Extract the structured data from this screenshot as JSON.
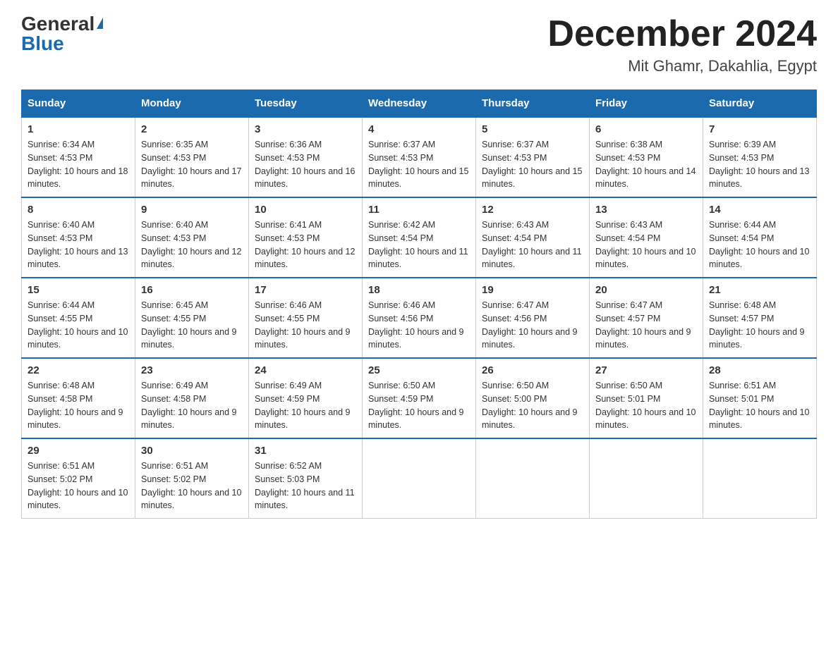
{
  "logo": {
    "general": "General",
    "triangle": "▶",
    "blue": "Blue"
  },
  "title": "December 2024",
  "subtitle": "Mit Ghamr, Dakahlia, Egypt",
  "days_of_week": [
    "Sunday",
    "Monday",
    "Tuesday",
    "Wednesday",
    "Thursday",
    "Friday",
    "Saturday"
  ],
  "weeks": [
    [
      {
        "day": "1",
        "sunrise": "6:34 AM",
        "sunset": "4:53 PM",
        "daylight": "10 hours and 18 minutes."
      },
      {
        "day": "2",
        "sunrise": "6:35 AM",
        "sunset": "4:53 PM",
        "daylight": "10 hours and 17 minutes."
      },
      {
        "day": "3",
        "sunrise": "6:36 AM",
        "sunset": "4:53 PM",
        "daylight": "10 hours and 16 minutes."
      },
      {
        "day": "4",
        "sunrise": "6:37 AM",
        "sunset": "4:53 PM",
        "daylight": "10 hours and 15 minutes."
      },
      {
        "day": "5",
        "sunrise": "6:37 AM",
        "sunset": "4:53 PM",
        "daylight": "10 hours and 15 minutes."
      },
      {
        "day": "6",
        "sunrise": "6:38 AM",
        "sunset": "4:53 PM",
        "daylight": "10 hours and 14 minutes."
      },
      {
        "day": "7",
        "sunrise": "6:39 AM",
        "sunset": "4:53 PM",
        "daylight": "10 hours and 13 minutes."
      }
    ],
    [
      {
        "day": "8",
        "sunrise": "6:40 AM",
        "sunset": "4:53 PM",
        "daylight": "10 hours and 13 minutes."
      },
      {
        "day": "9",
        "sunrise": "6:40 AM",
        "sunset": "4:53 PM",
        "daylight": "10 hours and 12 minutes."
      },
      {
        "day": "10",
        "sunrise": "6:41 AM",
        "sunset": "4:53 PM",
        "daylight": "10 hours and 12 minutes."
      },
      {
        "day": "11",
        "sunrise": "6:42 AM",
        "sunset": "4:54 PM",
        "daylight": "10 hours and 11 minutes."
      },
      {
        "day": "12",
        "sunrise": "6:43 AM",
        "sunset": "4:54 PM",
        "daylight": "10 hours and 11 minutes."
      },
      {
        "day": "13",
        "sunrise": "6:43 AM",
        "sunset": "4:54 PM",
        "daylight": "10 hours and 10 minutes."
      },
      {
        "day": "14",
        "sunrise": "6:44 AM",
        "sunset": "4:54 PM",
        "daylight": "10 hours and 10 minutes."
      }
    ],
    [
      {
        "day": "15",
        "sunrise": "6:44 AM",
        "sunset": "4:55 PM",
        "daylight": "10 hours and 10 minutes."
      },
      {
        "day": "16",
        "sunrise": "6:45 AM",
        "sunset": "4:55 PM",
        "daylight": "10 hours and 9 minutes."
      },
      {
        "day": "17",
        "sunrise": "6:46 AM",
        "sunset": "4:55 PM",
        "daylight": "10 hours and 9 minutes."
      },
      {
        "day": "18",
        "sunrise": "6:46 AM",
        "sunset": "4:56 PM",
        "daylight": "10 hours and 9 minutes."
      },
      {
        "day": "19",
        "sunrise": "6:47 AM",
        "sunset": "4:56 PM",
        "daylight": "10 hours and 9 minutes."
      },
      {
        "day": "20",
        "sunrise": "6:47 AM",
        "sunset": "4:57 PM",
        "daylight": "10 hours and 9 minutes."
      },
      {
        "day": "21",
        "sunrise": "6:48 AM",
        "sunset": "4:57 PM",
        "daylight": "10 hours and 9 minutes."
      }
    ],
    [
      {
        "day": "22",
        "sunrise": "6:48 AM",
        "sunset": "4:58 PM",
        "daylight": "10 hours and 9 minutes."
      },
      {
        "day": "23",
        "sunrise": "6:49 AM",
        "sunset": "4:58 PM",
        "daylight": "10 hours and 9 minutes."
      },
      {
        "day": "24",
        "sunrise": "6:49 AM",
        "sunset": "4:59 PM",
        "daylight": "10 hours and 9 minutes."
      },
      {
        "day": "25",
        "sunrise": "6:50 AM",
        "sunset": "4:59 PM",
        "daylight": "10 hours and 9 minutes."
      },
      {
        "day": "26",
        "sunrise": "6:50 AM",
        "sunset": "5:00 PM",
        "daylight": "10 hours and 9 minutes."
      },
      {
        "day": "27",
        "sunrise": "6:50 AM",
        "sunset": "5:01 PM",
        "daylight": "10 hours and 10 minutes."
      },
      {
        "day": "28",
        "sunrise": "6:51 AM",
        "sunset": "5:01 PM",
        "daylight": "10 hours and 10 minutes."
      }
    ],
    [
      {
        "day": "29",
        "sunrise": "6:51 AM",
        "sunset": "5:02 PM",
        "daylight": "10 hours and 10 minutes."
      },
      {
        "day": "30",
        "sunrise": "6:51 AM",
        "sunset": "5:02 PM",
        "daylight": "10 hours and 10 minutes."
      },
      {
        "day": "31",
        "sunrise": "6:52 AM",
        "sunset": "5:03 PM",
        "daylight": "10 hours and 11 minutes."
      },
      null,
      null,
      null,
      null
    ]
  ]
}
